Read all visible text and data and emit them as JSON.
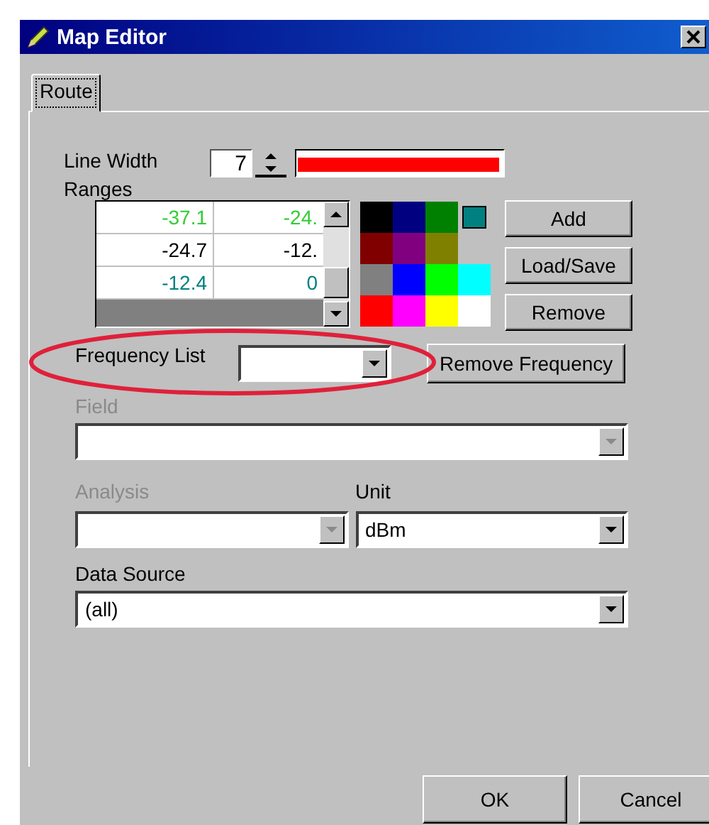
{
  "window": {
    "title": "Map Editor"
  },
  "tabs": [
    {
      "label": "Route",
      "selected": true
    }
  ],
  "line_width": {
    "label": "Line Width",
    "value": "7"
  },
  "ranges": {
    "label": "Ranges",
    "rows": [
      {
        "cells": [
          "-37.1",
          "-24."
        ],
        "color": "#33cc33"
      },
      {
        "cells": [
          "-24.7",
          "-12."
        ],
        "color": "#000000"
      },
      {
        "cells": [
          "-12.4",
          "0"
        ],
        "color": "#008080"
      }
    ]
  },
  "palette": [
    {
      "color": "#000000",
      "selected": false
    },
    {
      "color": "#000080",
      "selected": false
    },
    {
      "color": "#008000",
      "selected": false
    },
    {
      "color": "#008080",
      "selected": true
    },
    {
      "color": "#800000",
      "selected": false
    },
    {
      "color": "#800080",
      "selected": false
    },
    {
      "color": "#808000",
      "selected": false
    },
    {
      "color": "#808080",
      "selected": false
    },
    {
      "color": "#0000ff",
      "selected": false
    },
    {
      "color": "#00ff00",
      "selected": false
    },
    {
      "color": "#00ffff",
      "selected": false
    },
    {
      "color": "#ff0000",
      "selected": false
    },
    {
      "color": "#ff00ff",
      "selected": false
    },
    {
      "color": "#ffff00",
      "selected": false
    },
    {
      "color": "#ffffff",
      "selected": false
    }
  ],
  "range_buttons": [
    "Add",
    "Load/Save",
    "Remove"
  ],
  "frequency": {
    "label": "Frequency List",
    "button": "Remove Frequency"
  },
  "field": {
    "label": "Field",
    "disabled": true
  },
  "analysis": {
    "label": "Analysis",
    "disabled": true
  },
  "unit": {
    "label": "Unit",
    "value": "dBm",
    "disabled": false
  },
  "data_source": {
    "label": "Data Source",
    "value": "(all)",
    "disabled": false
  },
  "dialog_buttons": [
    "OK",
    "Cancel"
  ]
}
